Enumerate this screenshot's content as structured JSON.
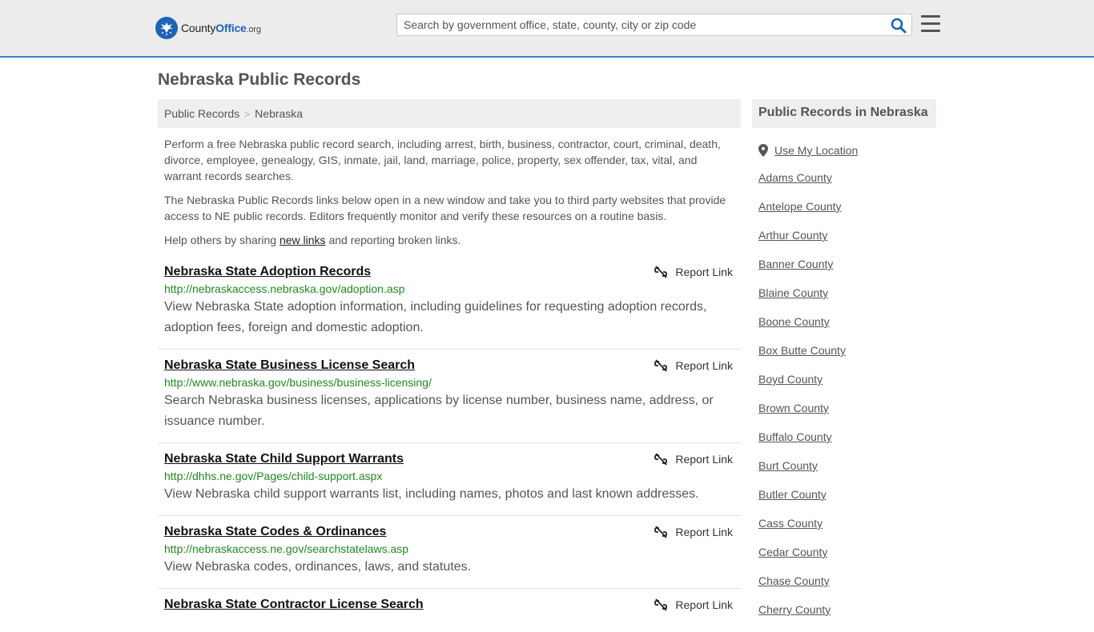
{
  "header": {
    "logo": {
      "county": "County",
      "office": "Office",
      "tld": ".org"
    },
    "search_placeholder": "Search by government office, state, county, city or zip code"
  },
  "page_title": "Nebraska Public Records",
  "breadcrumb": [
    "Public Records",
    "Nebraska"
  ],
  "intro": {
    "p1": "Perform a free Nebraska public record search, including arrest, birth, business, contractor, court, criminal, death, divorce, employee, genealogy, GIS, inmate, jail, land, marriage, police, property, sex offender, tax, vital, and warrant records searches.",
    "p2": "The Nebraska Public Records links below open in a new window and take you to third party websites that provide access to NE public records. Editors frequently monitor and verify these resources on a routine basis.",
    "p3_before": "Help others by sharing ",
    "p3_link": "new links",
    "p3_after": " and reporting broken links."
  },
  "report_label": "Report Link",
  "records": [
    {
      "title": "Nebraska State Adoption Records",
      "url": "http://nebraskaccess.nebraska.gov/adoption.asp",
      "desc": "View Nebraska State adoption information, including guidelines for requesting adoption records, adoption fees, foreign and domestic adoption."
    },
    {
      "title": "Nebraska State Business License Search",
      "url": "http://www.nebraska.gov/business/business-licensing/",
      "desc": "Search Nebraska business licenses, applications by license number, business name, address, or issuance number."
    },
    {
      "title": "Nebraska State Child Support Warrants",
      "url": "http://dhhs.ne.gov/Pages/child-support.aspx",
      "desc": "View Nebraska child support warrants list, including names, photos and last known addresses."
    },
    {
      "title": "Nebraska State Codes & Ordinances",
      "url": "http://nebraskaccess.ne.gov/searchstatelaws.asp",
      "desc": "View Nebraska codes, ordinances, laws, and statutes."
    },
    {
      "title": "Nebraska State Contractor License Search",
      "url": "",
      "desc": ""
    }
  ],
  "sidebar": {
    "heading": "Public Records in Nebraska",
    "use_location": "Use My Location",
    "counties": [
      "Adams County",
      "Antelope County",
      "Arthur County",
      "Banner County",
      "Blaine County",
      "Boone County",
      "Box Butte County",
      "Boyd County",
      "Brown County",
      "Buffalo County",
      "Burt County",
      "Butler County",
      "Cass County",
      "Cedar County",
      "Chase County",
      "Cherry County"
    ]
  },
  "colors": {
    "brand": "#1e63b4",
    "url_green": "#218921",
    "header_border": "#3d7dc8"
  }
}
